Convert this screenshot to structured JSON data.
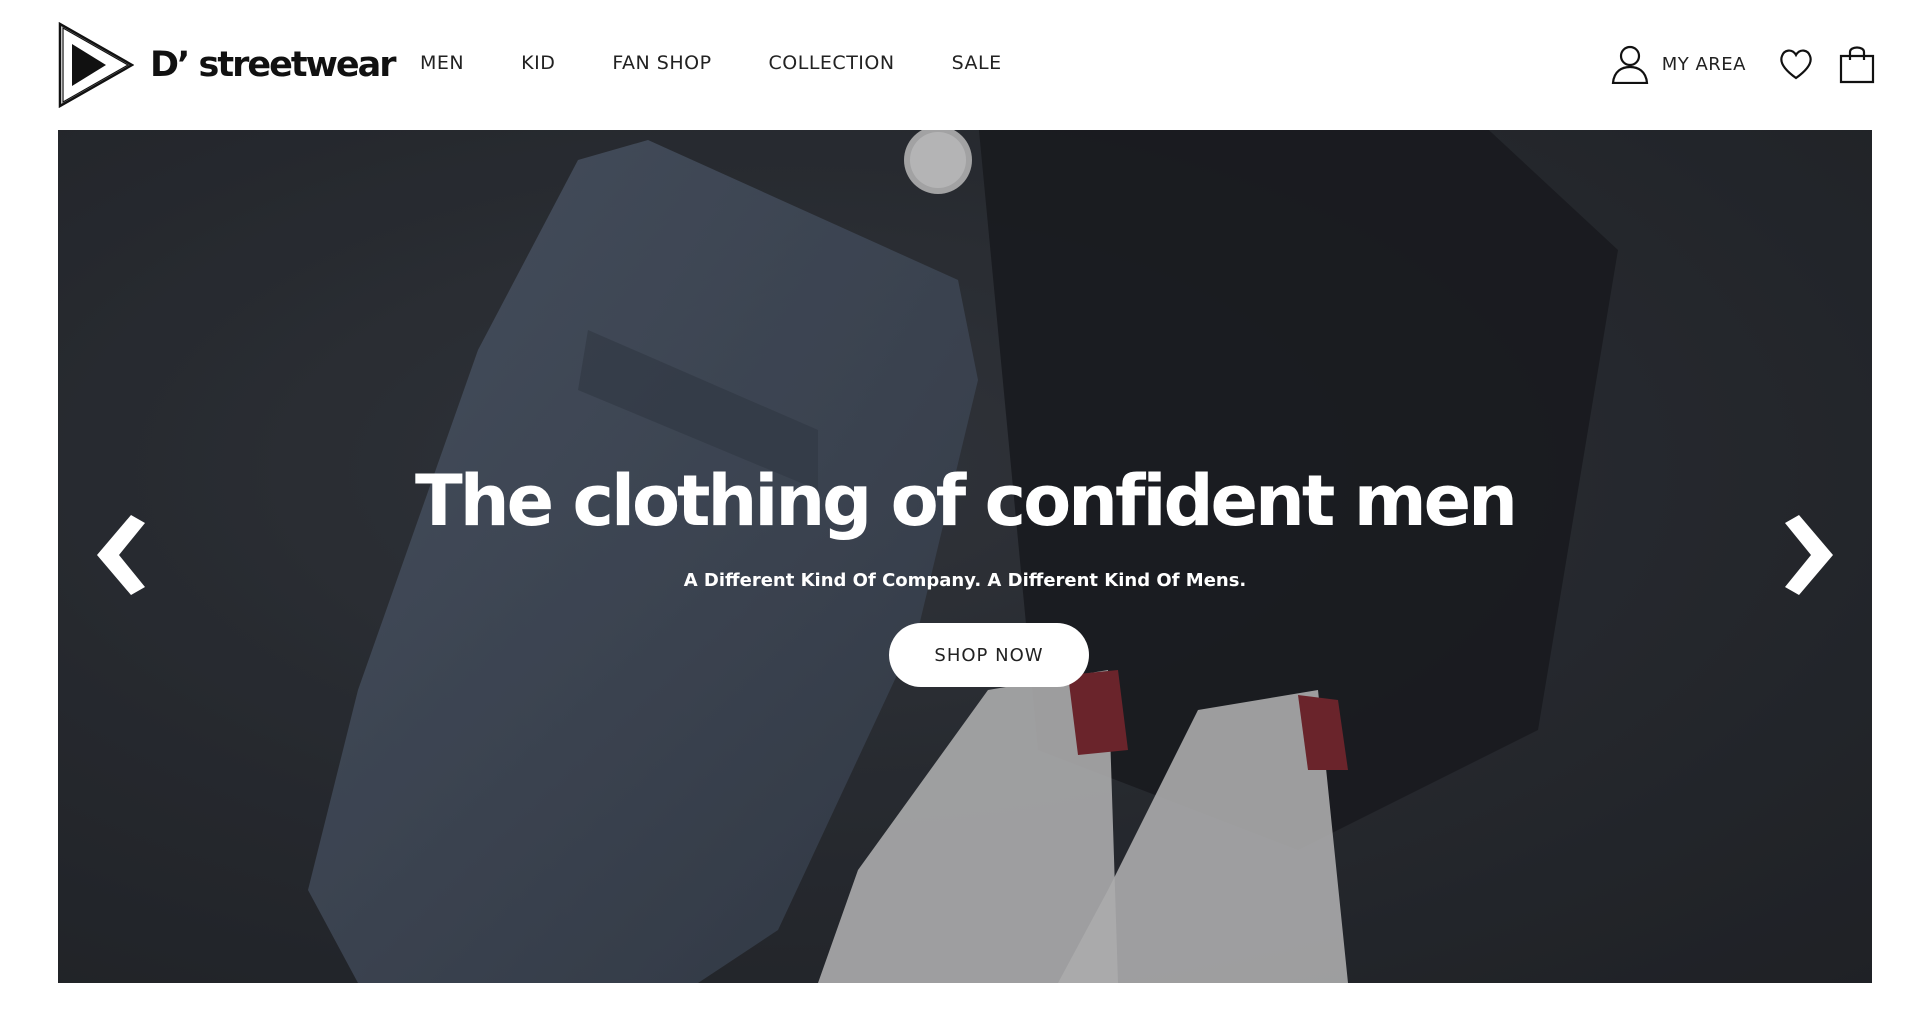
{
  "brand": {
    "name": "D’ streetwear"
  },
  "nav": {
    "items": [
      {
        "label": "MEN"
      },
      {
        "label": "KID"
      },
      {
        "label": "FAN SHOP"
      },
      {
        "label": "COLLECTION"
      },
      {
        "label": "SALE"
      }
    ]
  },
  "header": {
    "account_label": "MY AREA",
    "icons": [
      "user-icon",
      "heart-icon",
      "shopping-bag-icon"
    ]
  },
  "hero": {
    "title": "The clothing of confident men",
    "subtitle": "A Different Kind Of Company. A Different Kind Of Mens.",
    "cta_label": "SHOP NOW",
    "controls": [
      "chevron-left-icon",
      "chevron-right-icon"
    ]
  },
  "colors": {
    "text": "#111111",
    "hero_bg": "#2c3036",
    "button_bg": "#ffffff"
  }
}
